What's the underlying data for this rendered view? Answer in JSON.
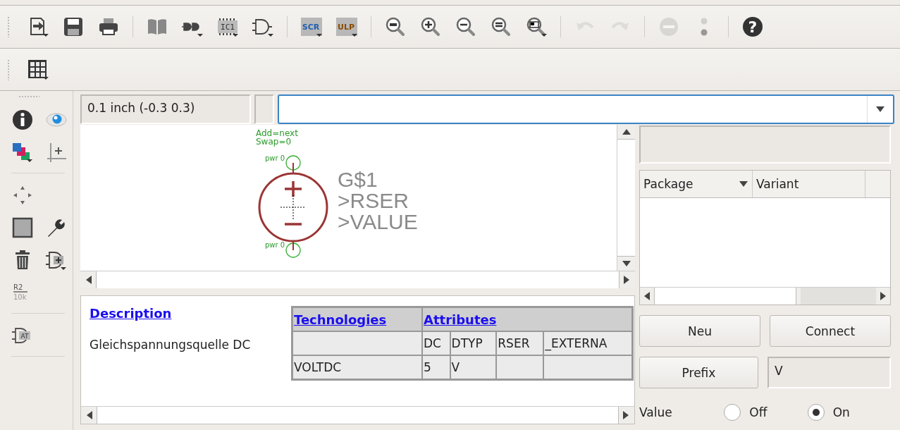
{
  "toolbar": {
    "groups": [
      [
        {
          "kind": "export",
          "disabled": false
        },
        {
          "kind": "save",
          "disabled": false
        },
        {
          "kind": "print",
          "disabled": false
        }
      ],
      [
        {
          "kind": "book",
          "disabled": false
        },
        {
          "kind": "connect",
          "disabled": false
        },
        {
          "kind": "chip",
          "label": "IC1",
          "disabled": false
        },
        {
          "kind": "gate",
          "disabled": false
        }
      ],
      [
        {
          "kind": "script",
          "label": "SCR",
          "disabled": false
        },
        {
          "kind": "ulp",
          "label": "ULP",
          "disabled": false
        }
      ],
      [
        {
          "kind": "zoomfit",
          "disabled": false
        },
        {
          "kind": "zoomin",
          "disabled": false
        },
        {
          "kind": "zoomout",
          "disabled": false
        },
        {
          "kind": "zoomredraw",
          "disabled": false
        },
        {
          "kind": "zoomselect",
          "disabled": false
        }
      ],
      [
        {
          "kind": "undo",
          "disabled": true
        },
        {
          "kind": "redo",
          "disabled": true
        }
      ],
      [
        {
          "kind": "stop",
          "disabled": true
        },
        {
          "kind": "dots",
          "disabled": false
        }
      ],
      [
        {
          "kind": "help",
          "label": "?",
          "disabled": false
        }
      ]
    ]
  },
  "toolbar_2": {
    "items": [
      {
        "kind": "grid"
      }
    ]
  },
  "tools": {
    "groups": [
      [
        [
          {
            "kind": "info"
          },
          {
            "kind": "eye"
          }
        ],
        [
          {
            "kind": "layers"
          },
          {
            "kind": "mark"
          }
        ]
      ],
      [
        [
          {
            "kind": "move"
          }
        ],
        [
          {
            "kind": "rect"
          },
          {
            "kind": "wrench"
          }
        ],
        [
          {
            "kind": "delete"
          },
          {
            "kind": "addgate"
          }
        ],
        [
          {
            "kind": "name",
            "label": "R2",
            "sublabel": "10k"
          }
        ]
      ],
      [
        [
          {
            "kind": "attribute",
            "label": "AT"
          }
        ]
      ]
    ]
  },
  "grid_status": "0.1 inch (-0.3 0.3)",
  "canvas": {
    "gate_attributes": [
      "Add=next",
      "Swap=0"
    ],
    "pins": [
      "pwr 0",
      "pwr 0"
    ],
    "labels": [
      "G$1",
      ">RSER",
      ">VALUE"
    ]
  },
  "description": {
    "heading": "Description",
    "text": "Gleichspannungsquelle DC"
  },
  "technologies": {
    "heading": "Technologies",
    "attributes_heading": "Attributes",
    "columns": [
      "DC",
      "DTYP",
      "RSER",
      "_EXTERNA"
    ],
    "rows": [
      {
        "name": "VOLTDC",
        "values": [
          "5",
          "V"
        ]
      }
    ]
  },
  "packages": {
    "columns": [
      "Package",
      "Variant"
    ]
  },
  "buttons": [
    "Neu",
    "Connect"
  ],
  "prefix": {
    "button": "Prefix",
    "value": "V"
  },
  "value_option": {
    "label": "Value",
    "options": [
      {
        "label": "Off",
        "selected": false
      },
      {
        "label": "On",
        "selected": true
      }
    ]
  }
}
